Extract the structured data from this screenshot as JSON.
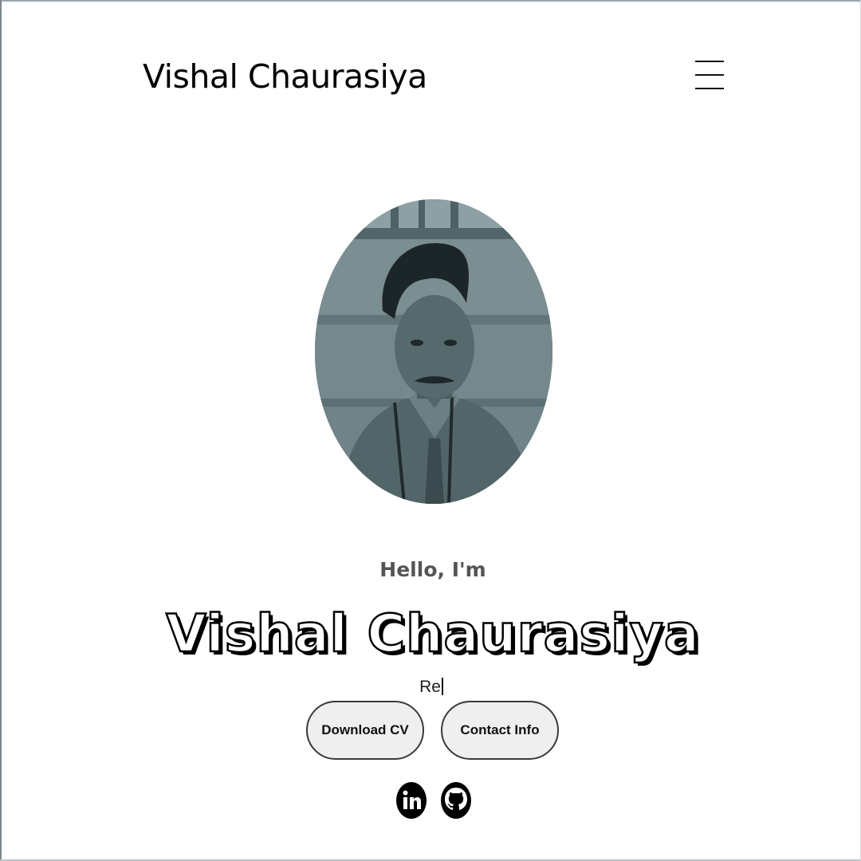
{
  "header": {
    "logo_text": "Vishal Chaurasiya",
    "menu_icon": "hamburger-menu-icon"
  },
  "hero": {
    "photo_alt": "profile-photo",
    "greeting": "Hello, I'm",
    "name": "Vishal Chaurasiya",
    "typed_text": "Re"
  },
  "buttons": {
    "download_cv": "Download CV",
    "contact_info": "Contact Info"
  },
  "social": {
    "linkedin_icon": "linkedin-icon",
    "github_icon": "github-icon"
  },
  "colors": {
    "background": "#ffffff",
    "text": "#000000",
    "greeting_text": "#555555",
    "button_bg": "#efefef",
    "button_border": "#3a3a3a",
    "photo_tint": "#5d7177"
  }
}
